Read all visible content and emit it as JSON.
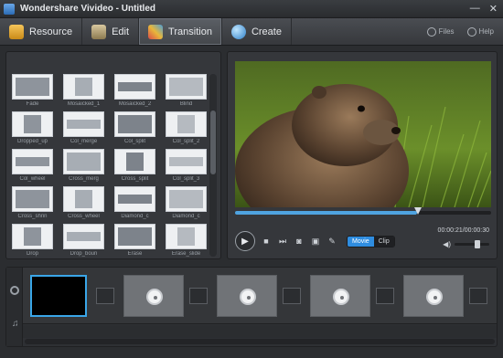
{
  "app": {
    "title": "Wondershare Vivideo - Untitled"
  },
  "window_controls": {
    "minimize": "—",
    "close": "✕"
  },
  "toolbar": {
    "tabs": [
      {
        "label": "Resource",
        "icon": "resource-icon"
      },
      {
        "label": "Edit",
        "icon": "edit-icon"
      },
      {
        "label": "Transition",
        "icon": "transition-icon",
        "active": true
      },
      {
        "label": "Create",
        "icon": "create-icon"
      }
    ],
    "files_label": "Files",
    "help_label": "Help"
  },
  "transitions": [
    "Fade",
    "Mosaicked_1",
    "Mosaicked_2",
    "Blind",
    "Dropped_up",
    "Col_merge",
    "Col_split",
    "Col_split_2",
    "Col_wheel",
    "Cross_merg",
    "Cross_split",
    "Col_split_3",
    "Cross_shrin",
    "Cross_wheel",
    "Diamond_c",
    "Diamond_c",
    "Drop",
    "Drop_boun",
    "Erase",
    "Erase_slide"
  ],
  "player": {
    "progress": 0.71,
    "time": "00:00:21/00:00:30",
    "mode_movie": "Movie",
    "mode_clip": "Clip",
    "volume": 0.6
  },
  "colors": {
    "accent": "#2f8de0",
    "selection": "#3aa6e8"
  }
}
